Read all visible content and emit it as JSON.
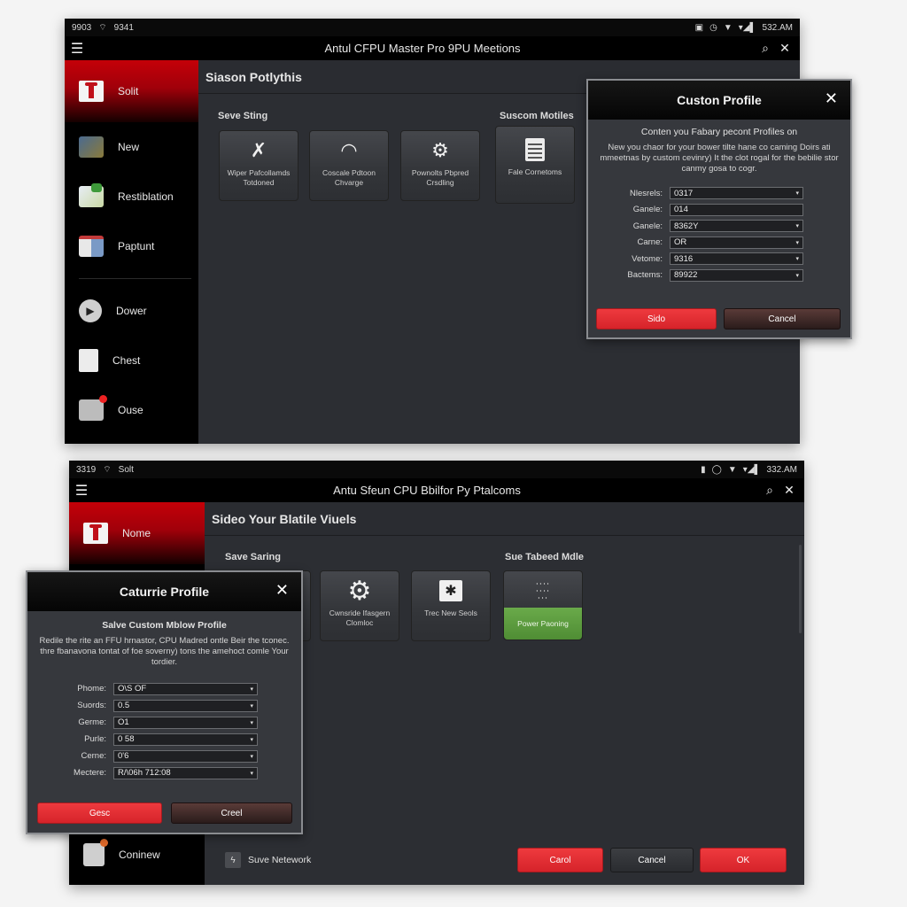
{
  "window1": {
    "status": {
      "left_time": "9903",
      "left_text": "9341",
      "right_time": "532.AM"
    },
    "app_title": "Antul CFPU Master Pro 9PU Meetions",
    "sidebar": {
      "items": [
        {
          "label": "Solit",
          "icon": "home-icon",
          "active": true
        },
        {
          "label": "New",
          "icon": "grid-icon"
        },
        {
          "label": "Restiblation",
          "icon": "chart-icon"
        },
        {
          "label": "Paptunt",
          "icon": "cards-icon"
        },
        {
          "label": "Dower",
          "icon": "play-icon"
        },
        {
          "label": "Chest",
          "icon": "clipboard-icon"
        },
        {
          "label": "Ouse",
          "icon": "notification-icon"
        }
      ]
    },
    "main": {
      "header": "Siason Potlythis",
      "section_left": "Seve Sting",
      "section_right": "Suscom Motiles",
      "tiles": [
        {
          "label": "Wiper Pafcollamds Totdoned",
          "icon": "tools-icon"
        },
        {
          "label": "Coscale Pdtoon Chvarge",
          "icon": "gauge-icon"
        },
        {
          "label": "Pownolts Pbpred Crsdling",
          "icon": "gear-icon"
        },
        {
          "label": "Fale Cornetoms",
          "icon": "calculator-icon"
        }
      ]
    },
    "dialog": {
      "title": "Custon Profile",
      "subtitle": "Conten you Fabary pecont Profiles on",
      "text": "New you chaor for your bower tilte hane co caming Doirs ati mmeetnas by custom cevinry) It the clot rogal for the bebilie stor canmy gosa to cogr.",
      "fields": [
        {
          "label": "Nlesrels:",
          "value": "0317",
          "dropdown": true
        },
        {
          "label": "Ganele:",
          "value": "014",
          "dropdown": false
        },
        {
          "label": "Ganele:",
          "value": "8362Y",
          "dropdown": true
        },
        {
          "label": "Carne:",
          "value": "OR",
          "dropdown": true
        },
        {
          "label": "Vetome:",
          "value": "9316",
          "dropdown": true
        },
        {
          "label": "Bactems:",
          "value": "89922",
          "dropdown": true
        }
      ],
      "primary_button": "Sido",
      "secondary_button": "Cancel"
    }
  },
  "window2": {
    "status": {
      "left_time": "3319",
      "left_text": "Solt",
      "right_time": "332.AM"
    },
    "app_title": "Antu Sfeun CPU Bbilfor Py Ptalcoms",
    "sidebar": {
      "items": [
        {
          "label": "Nome",
          "icon": "home-icon",
          "active": true
        },
        {
          "label": "Coninew",
          "icon": "notification-icon"
        }
      ]
    },
    "main": {
      "header": "Sideo Your Blatile Viuels",
      "section_left": "Save Saring",
      "section_right": "Sue Tabeed Mdle",
      "tiles": [
        {
          "label": "",
          "icon": ""
        },
        {
          "label": "Cwnsride Ifasgern Clomloc",
          "icon": "gear-icon"
        },
        {
          "label": "Trec New Seols",
          "icon": "gift-icon"
        },
        {
          "label": "Power Paoning",
          "icon": "dots-grid-icon",
          "highlight": true
        }
      ],
      "footer_toggle": "Suve Netework",
      "footer_buttons": [
        "Carol",
        "Cancel",
        "OK"
      ]
    },
    "dialog": {
      "title": "Caturrie Profile",
      "subtitle": "Salve Custom Mblow Profile",
      "text": "Redile the rite an FFU hrnastor, CPU Madred ontle Beir the tconec. thre fbanavona tontat of foe soverny) tons the amehoct comle Your tordier.",
      "fields": [
        {
          "label": "Phome:",
          "value": "O\\S OF"
        },
        {
          "label": "Suords:",
          "value": "0.5"
        },
        {
          "label": "Germe:",
          "value": "O1"
        },
        {
          "label": "Purle:",
          "value": "0 58"
        },
        {
          "label": "Cerne:",
          "value": "0'6"
        },
        {
          "label": "Mectere:",
          "value": "R/\\06h 712:08"
        }
      ],
      "primary_button": "Gesc",
      "secondary_button": "Creel"
    }
  },
  "colors": {
    "accent_red": "#d6232a",
    "highlight_green": "#5a9a3c",
    "panel": "#2c2e33"
  }
}
